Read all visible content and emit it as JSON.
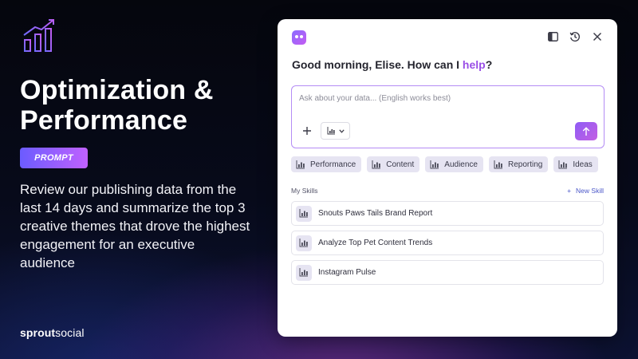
{
  "hero": {
    "title_line1": "Optimization &",
    "title_line2": "Performance",
    "badge": "PROMPT",
    "body": "Review our publishing data from the last 14 days and summarize the top 3 creative themes that drove the highest engagement for an executive audience",
    "brand_part1": "sprout",
    "brand_part2": "social"
  },
  "panel": {
    "greeting_prefix": "Good morning, Elise. How can I ",
    "greeting_highlight": "help",
    "greeting_suffix": "?",
    "input_placeholder": "Ask about your data... (English works best)",
    "chips": [
      {
        "label": "Performance",
        "icon": "chart-icon"
      },
      {
        "label": "Content",
        "icon": "chart-icon"
      },
      {
        "label": "Audience",
        "icon": "chart-icon"
      },
      {
        "label": "Reporting",
        "icon": "chart-icon"
      },
      {
        "label": "Ideas",
        "icon": "chart-icon"
      }
    ],
    "skills_title": "My Skills",
    "new_skill_label": "New Skill",
    "skills": [
      {
        "label": "Snouts Paws Tails Brand Report"
      },
      {
        "label": "Analyze Top Pet Content Trends"
      },
      {
        "label": "Instagram Pulse"
      }
    ]
  },
  "colors": {
    "accent": "#9a4fe6",
    "badge_gradient_start": "#6b5cff",
    "badge_gradient_end": "#c061ff"
  }
}
